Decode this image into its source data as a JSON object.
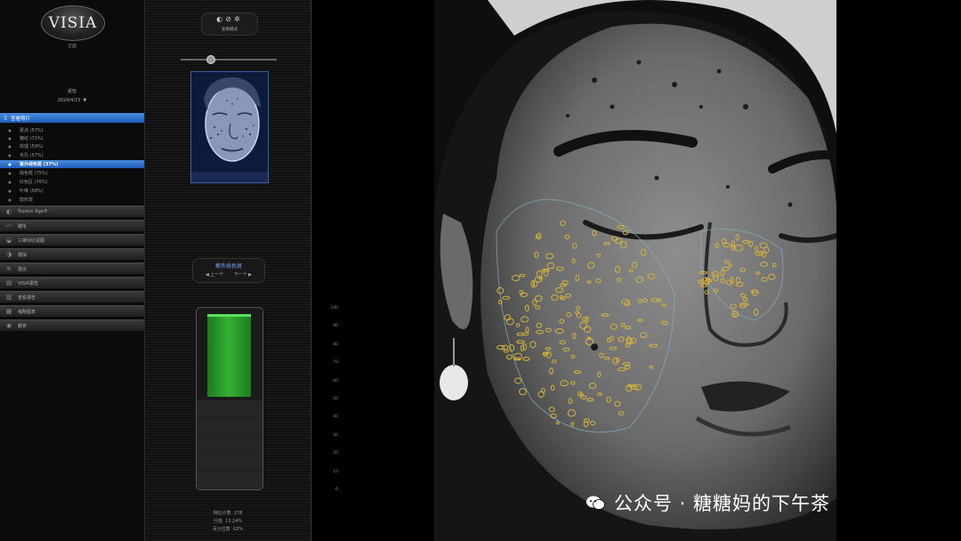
{
  "app": {
    "logo": "VISIA",
    "logo_sub": "正面"
  },
  "patient": {
    "name": "受检",
    "date": "2024/4/15"
  },
  "nav": {
    "active_category": "查看照片",
    "items": [
      {
        "label": "斑点 (57%)"
      },
      {
        "label": "皱纹 (71%)"
      },
      {
        "label": "纹理 (59%)"
      },
      {
        "label": "毛孔 (57%)"
      },
      {
        "label": "紫外线色斑 (37%)",
        "selected": true
      },
      {
        "label": "棕色斑 (75%)"
      },
      {
        "label": "红色区 (76%)"
      },
      {
        "label": "卟啉 (58%)"
      },
      {
        "label": "隐形斑"
      }
    ],
    "categories": [
      {
        "label": "Truskin Age®",
        "icon": "face-icon"
      },
      {
        "label": "睫毛",
        "icon": "eyelash-icon"
      },
      {
        "label": "三维对比视图",
        "icon": "3d-icon"
      },
      {
        "label": "模拟",
        "icon": "simulation-icon"
      },
      {
        "label": "建议",
        "icon": "suggestion-icon"
      },
      {
        "label": "VISIA报告",
        "icon": "report-icon"
      },
      {
        "label": "查看报告",
        "icon": "view-report-icon"
      },
      {
        "label": "缩略图表",
        "icon": "thumbnails-icon"
      },
      {
        "label": "教育",
        "icon": "education-icon"
      }
    ]
  },
  "analysis": {
    "mode_label": "查看模式",
    "feature_title": "紫外线色斑",
    "prev_label": "◀ 上一个",
    "next_label": "下一个 ▶",
    "score_percent": 90,
    "axis_ticks": [
      "100",
      "90",
      "80",
      "70",
      "60",
      "50",
      "40",
      "30",
      "20",
      "10",
      "0"
    ],
    "stats": [
      {
        "label": "特征计数",
        "value": "278"
      },
      {
        "label": "分值",
        "value": "13.24%"
      },
      {
        "label": "百分位数",
        "value": "62%"
      }
    ]
  },
  "watermark": {
    "text": "公众号 · 糖糖妈的下午茶"
  },
  "colors": {
    "accent": "#2f6fd0",
    "bar": "#35b035",
    "spot_outline": "#d6b43a"
  }
}
